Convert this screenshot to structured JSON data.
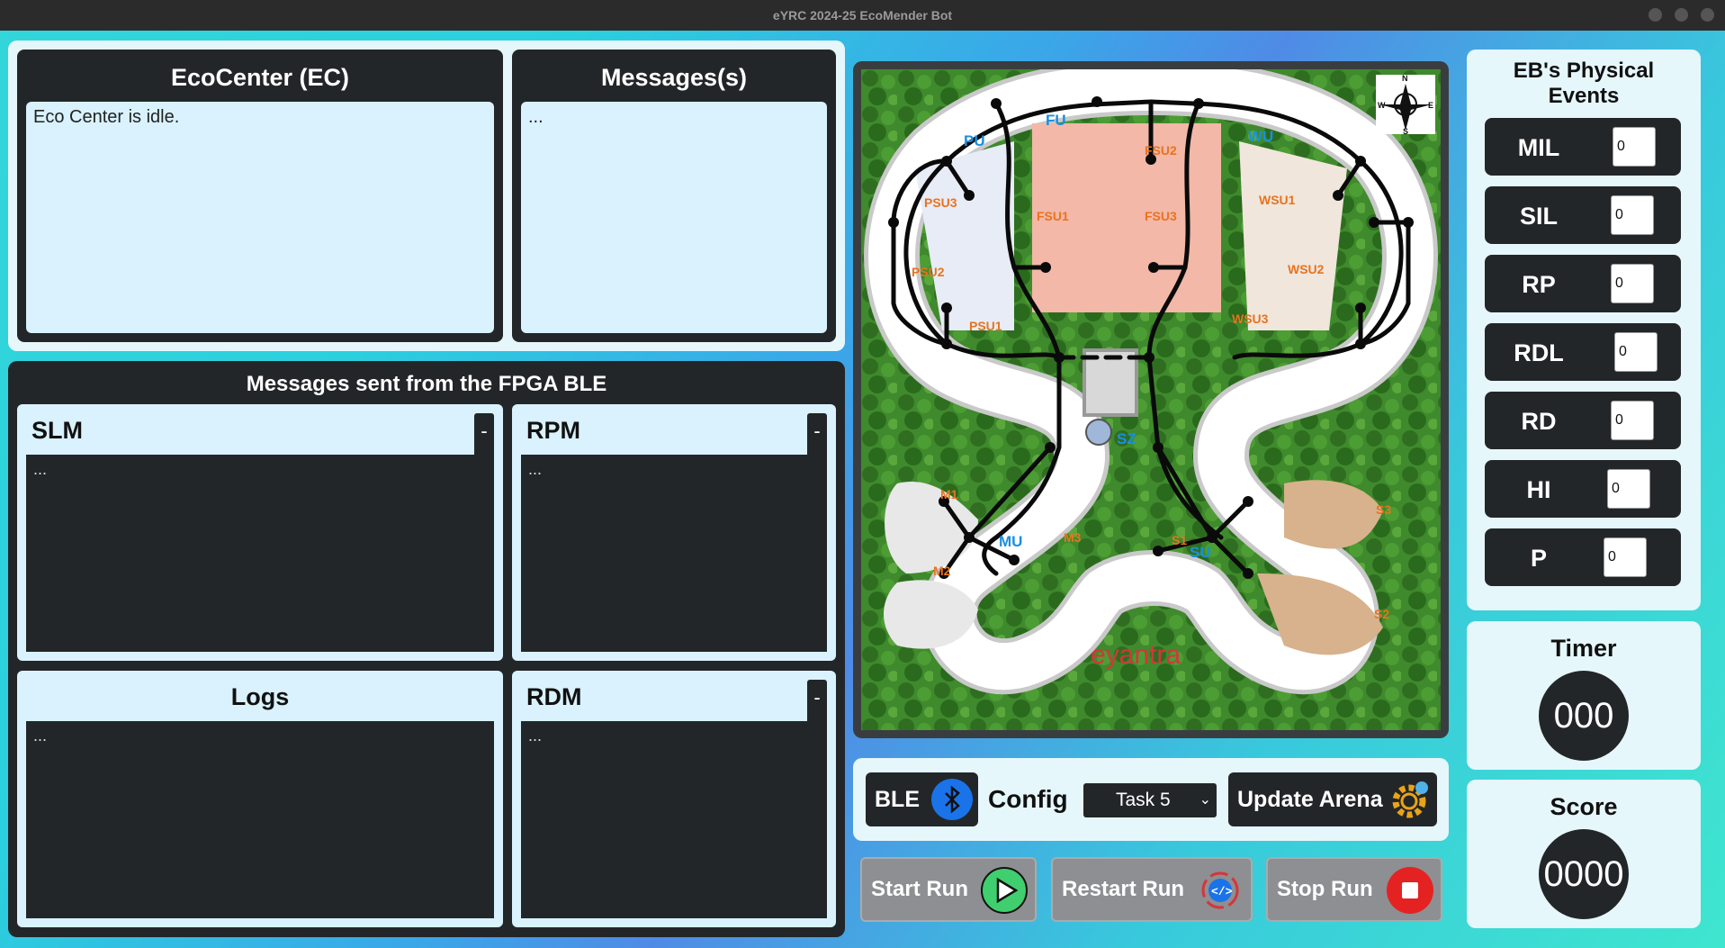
{
  "window": {
    "title": "eYRC 2024-25 EcoMender Bot"
  },
  "ecocenter": {
    "title": "EcoCenter (EC)",
    "text": "Eco Center is idle."
  },
  "messages": {
    "title": "Messages(s)",
    "text": "..."
  },
  "fpga": {
    "title": "Messages sent from the FPGA BLE",
    "slm": {
      "title": "SLM",
      "min": "-",
      "text": "..."
    },
    "rpm": {
      "title": "RPM",
      "min": "-",
      "text": "..."
    },
    "logs": {
      "title": "Logs",
      "text": "..."
    },
    "rdm": {
      "title": "RDM",
      "min": "-",
      "text": "..."
    }
  },
  "arena": {
    "compass": {
      "n": "N",
      "s": "S",
      "e": "E",
      "w": "W"
    },
    "labels": {
      "fu": "FU",
      "pu": "PU",
      "wu": "WU",
      "sz": "SZ",
      "mu": "MU",
      "su": "SU",
      "fsu1": "FSU1",
      "fsu2": "FSU2",
      "fsu3": "FSU3",
      "psu1": "PSU1",
      "psu2": "PSU2",
      "psu3": "PSU3",
      "wsu1": "WSU1",
      "wsu2": "WSU2",
      "wsu3": "WSU3",
      "m1": "M1",
      "m2": "M2",
      "m3": "M3",
      "s1": "S1",
      "s2": "S2",
      "s3": "S3"
    },
    "logo": "eyantra"
  },
  "controls": {
    "ble_label": "BLE",
    "config_label": "Config",
    "task_select": "Task 5",
    "update_arena": "Update Arena",
    "start_run": "Start Run",
    "restart_run": "Restart Run",
    "stop_run": "Stop Run"
  },
  "events": {
    "title": "EB's Physical Events",
    "items": [
      {
        "label": "MIL",
        "value": "0"
      },
      {
        "label": "SIL",
        "value": "0"
      },
      {
        "label": "RP",
        "value": "0"
      },
      {
        "label": "RDL",
        "value": "0"
      },
      {
        "label": "RD",
        "value": "0"
      },
      {
        "label": "HI",
        "value": "0"
      },
      {
        "label": "P",
        "value": "0"
      }
    ]
  },
  "timer": {
    "title": "Timer",
    "value": "000"
  },
  "score": {
    "title": "Score",
    "value": "0000"
  },
  "colors": {
    "dark": "#232629",
    "light": "#d9f2fd",
    "accent_blue": "#1a8fe0",
    "orange": "#e8731f"
  }
}
